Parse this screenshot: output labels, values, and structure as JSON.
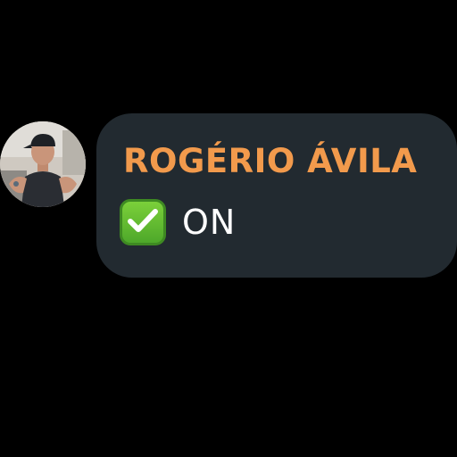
{
  "contact": {
    "name": "ROGÉRIO ÁVILA",
    "status": "ON",
    "status_icon": "check-mark-button-icon",
    "avatar_icon": "profile-photo"
  },
  "colors": {
    "background": "#000000",
    "bubble": "#222a30",
    "name": "#f29a4c",
    "status": "#ffffff",
    "check": "#5cb82e"
  }
}
